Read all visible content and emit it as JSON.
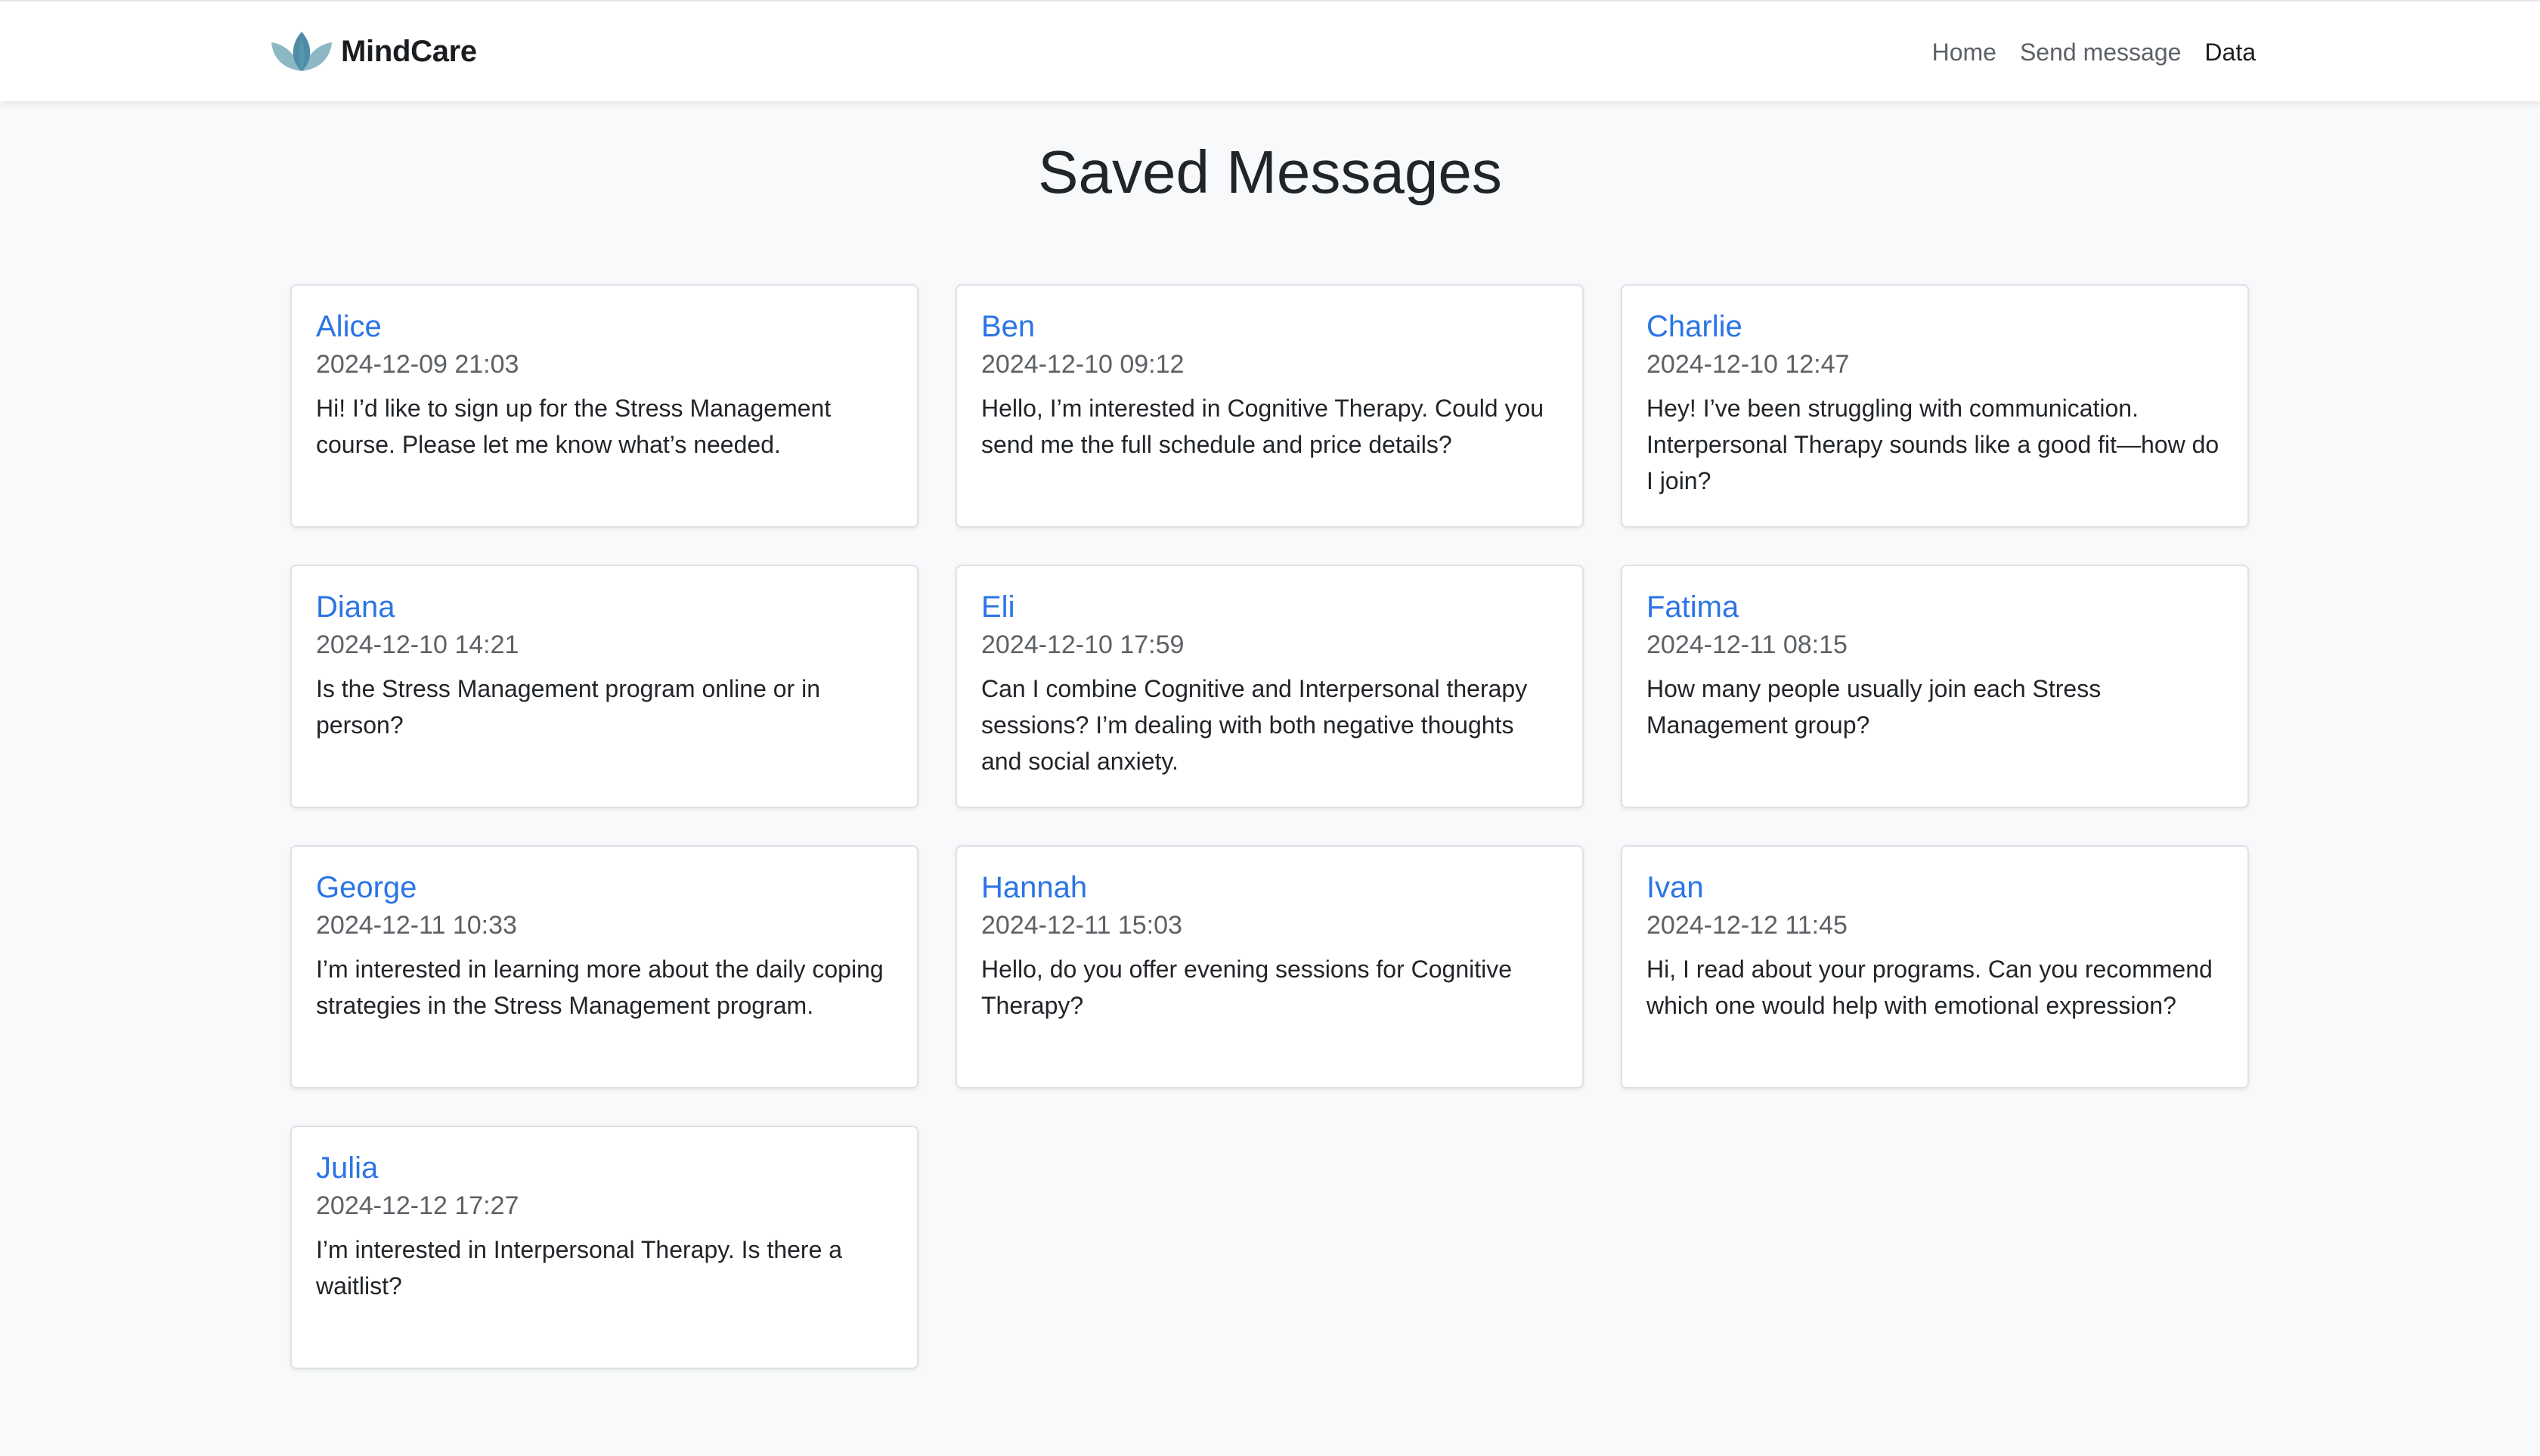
{
  "brand": {
    "name": "MindCare",
    "logo_icon": "lotus-icon",
    "logo_colors": [
      "#8cb8c4",
      "#5f9fb0",
      "#4d8ba6"
    ]
  },
  "nav": {
    "items": [
      {
        "label": "Home"
      },
      {
        "label": "Send message"
      },
      {
        "label": "Data"
      }
    ],
    "active": "Data"
  },
  "page": {
    "title": "Saved Messages"
  },
  "colors": {
    "accent": "#2b74e6",
    "background": "#f8f9fa",
    "card": "#ffffff"
  },
  "messages": [
    {
      "name": "Alice",
      "time": "2024-12-09 21:03",
      "text": "Hi! I’d like to sign up for the Stress Management course. Please let me know what’s needed."
    },
    {
      "name": "Ben",
      "time": "2024-12-10 09:12",
      "text": "Hello, I’m interested in Cognitive Therapy. Could you send me the full schedule and price details?"
    },
    {
      "name": "Charlie",
      "time": "2024-12-10 12:47",
      "text": "Hey! I’ve been struggling with communication. Interpersonal Therapy sounds like a good fit—how do I join?"
    },
    {
      "name": "Diana",
      "time": "2024-12-10 14:21",
      "text": "Is the Stress Management program online or in person?"
    },
    {
      "name": "Eli",
      "time": "2024-12-10 17:59",
      "text": "Can I combine Cognitive and Interpersonal therapy sessions? I’m dealing with both negative thoughts and social anxiety."
    },
    {
      "name": "Fatima",
      "time": "2024-12-11 08:15",
      "text": "How many people usually join each Stress Management group?"
    },
    {
      "name": "George",
      "time": "2024-12-11 10:33",
      "text": "I’m interested in learning more about the daily coping strategies in the Stress Management program."
    },
    {
      "name": "Hannah",
      "time": "2024-12-11 15:03",
      "text": "Hello, do you offer evening sessions for Cognitive Therapy?"
    },
    {
      "name": "Ivan",
      "time": "2024-12-12 11:45",
      "text": "Hi, I read about your programs. Can you recommend which one would help with emotional expression?"
    },
    {
      "name": "Julia",
      "time": "2024-12-12 17:27",
      "text": "I’m interested in Interpersonal Therapy. Is there a waitlist?"
    }
  ]
}
